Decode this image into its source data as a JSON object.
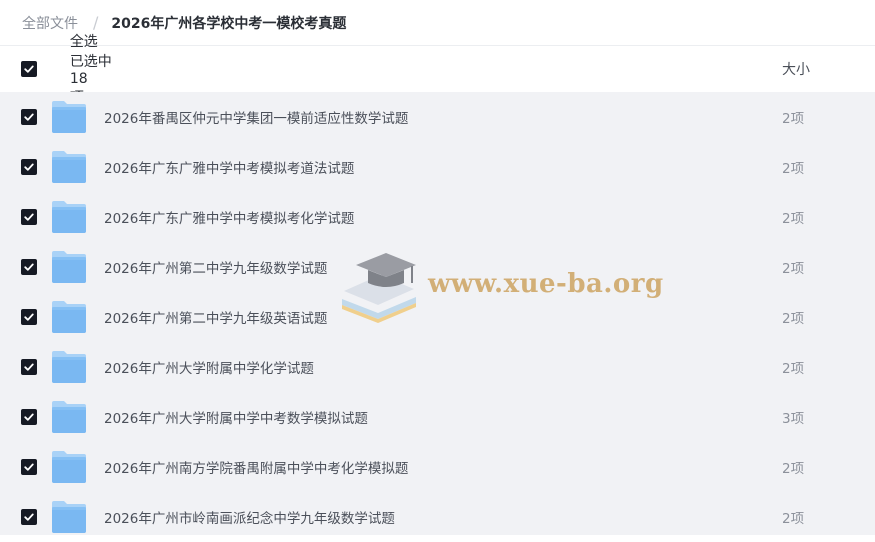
{
  "breadcrumb": {
    "root": "全部文件",
    "current": "2026年广州各学校中考一模校考真题"
  },
  "header": {
    "select_all": "全选",
    "selected_prefix": "已选中",
    "selected_count": "18",
    "selected_unit": "项",
    "size_label": "大小"
  },
  "files": [
    {
      "name": "2026年番禺区仲元中学集团一模前适应性数学试题",
      "size": "2项"
    },
    {
      "name": "2026年广东广雅中学中考模拟考道法试题",
      "size": "2项"
    },
    {
      "name": "2026年广东广雅中学中考模拟考化学试题",
      "size": "2项"
    },
    {
      "name": "2026年广州第二中学九年级数学试题",
      "size": "2项"
    },
    {
      "name": "2026年广州第二中学九年级英语试题",
      "size": "2项"
    },
    {
      "name": "2026年广州大学附属中学化学试题",
      "size": "2项"
    },
    {
      "name": "2026年广州大学附属中学中考数学模拟试题",
      "size": "3项"
    },
    {
      "name": "2026年广州南方学院番禺附属中学中考化学模拟题",
      "size": "2项"
    },
    {
      "name": "2026年广州市岭南画派纪念中学九年级数学试题",
      "size": "2项"
    }
  ],
  "watermark": {
    "text": "www.xue-ba.org"
  },
  "colors": {
    "checkbox": "#161a24",
    "folder_front": "#7ab8f2",
    "folder_back": "#a9d2f7",
    "list_bg": "#f1f2f5"
  }
}
